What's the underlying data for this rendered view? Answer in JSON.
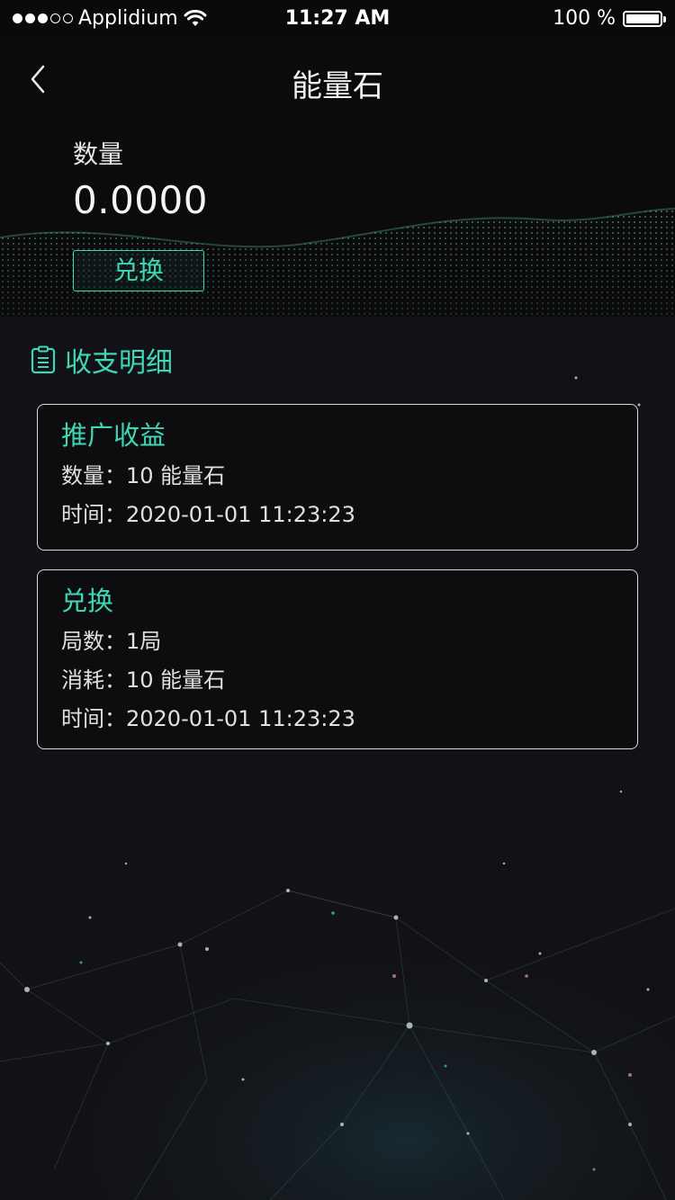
{
  "status_bar": {
    "carrier": "Applidium",
    "time": "11:27 AM",
    "battery": "100 %",
    "signal_icon": "signal-dots-icon",
    "wifi_icon": "wifi-icon",
    "battery_icon": "battery-icon",
    "battery_level": 1.0
  },
  "nav": {
    "title": "能量石",
    "back_icon": "chevron-left-icon"
  },
  "balance": {
    "label": "数量",
    "value": "0.0000",
    "exchange_label": "兑换"
  },
  "records": {
    "title": "收支明细",
    "icon": "clipboard-list-icon",
    "items": [
      {
        "title": "推广收益",
        "rows": [
          "数量：10 能量石",
          "时间：2020-01-01 11:23:23"
        ]
      },
      {
        "title": "兑换",
        "rows": [
          "局数：1局",
          "消耗：10 能量石",
          "时间：2020-01-01 11:23:23"
        ]
      }
    ]
  },
  "colors": {
    "accent": "#3ed6b5",
    "background": "#121216",
    "header_background": "#0b0b0c",
    "card_border": "#d9d9d9"
  }
}
